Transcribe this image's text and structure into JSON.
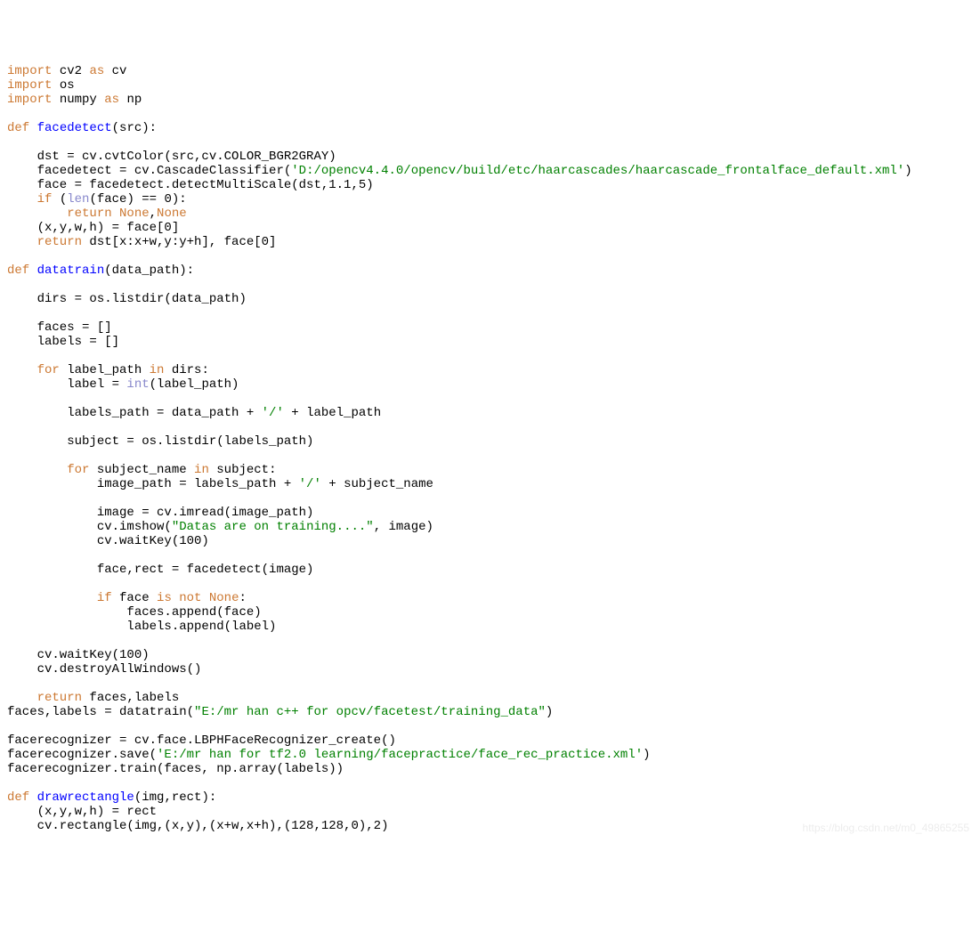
{
  "code": {
    "l1_import": "import",
    "l1_cv2": " cv2 ",
    "l1_as": "as",
    "l1_cv": " cv",
    "l2_import": "import",
    "l2_os": " os",
    "l3_import": "import",
    "l3_numpy": " numpy ",
    "l3_as": "as",
    "l3_np": " np",
    "l5_def": "def",
    "l5_fn": " facedetect",
    "l5_sig": "(src):",
    "l7": "    dst = cv.cvtColor(src,cv.COLOR_BGR2GRAY)",
    "l8a": "    facedetect = cv.CascadeClassifier(",
    "l8s": "'D:/opencv4.4.0/opencv/build/etc/haarcascades/haarcascade_frontalface_default.xml'",
    "l8b": ")",
    "l9": "    face = facedetect.detectMultiScale(dst,1.1,5)",
    "l10_if": "    if",
    "l10a": " (",
    "l10_len": "len",
    "l10b": "(face) == 0):",
    "l11_return": "        return",
    "l11_none": " None",
    "l11_comma": ",",
    "l11_none2": "None",
    "l12": "    (x,y,w,h) = face[0]",
    "l13_return": "    return",
    "l13b": " dst[x:x+w,y:y+h], face[0]",
    "l15_def": "def",
    "l15_fn": " datatrain",
    "l15_sig": "(data_path):",
    "l17": "    dirs = os.listdir(data_path)",
    "l19": "    faces = []",
    "l20": "    labels = []",
    "l22_for": "    for",
    "l22a": " label_path ",
    "l22_in": "in",
    "l22b": " dirs:",
    "l23a": "        label = ",
    "l23_int": "int",
    "l23b": "(label_path)",
    "l25a": "        labels_path = data_path + ",
    "l25s": "'/'",
    "l25b": " + label_path",
    "l27": "        subject = os.listdir(labels_path)",
    "l29_for": "        for",
    "l29a": " subject_name ",
    "l29_in": "in",
    "l29b": " subject:",
    "l30a": "            image_path = labels_path + ",
    "l30s": "'/'",
    "l30b": " + subject_name",
    "l32": "            image = cv.imread(image_path)",
    "l33a": "            cv.imshow(",
    "l33s": "\"Datas are on training....\"",
    "l33b": ", image)",
    "l34": "            cv.waitKey(100)",
    "l36": "            face,rect = facedetect(image)",
    "l38_if": "            if",
    "l38a": " face ",
    "l38_isnot": "is not",
    "l38_none": " None",
    "l38b": ":",
    "l39": "                faces.append(face)",
    "l40": "                labels.append(label)",
    "l42": "    cv.waitKey(100)",
    "l43": "    cv.destroyAllWindows()",
    "l45_return": "    return",
    "l45b": " faces,labels",
    "l46a": "faces,labels = datatrain(",
    "l46s": "\"E:/mr han c++ for opcv/facetest/training_data\"",
    "l46b": ")",
    "l48": "facerecognizer = cv.face.LBPHFaceRecognizer_create()",
    "l49a": "facerecognizer.save(",
    "l49s": "'E:/mr han for tf2.0 learning/facepractice/face_rec_practice.xml'",
    "l49b": ")",
    "l50": "facerecognizer.train(faces, np.array(labels))",
    "l52_def": "def",
    "l52_fn": " drawrectangle",
    "l52_sig": "(img,rect):",
    "l53": "    (x,y,w,h) = rect",
    "l54": "    cv.rectangle(img,(x,y),(x+w,x+h),(128,128,0),2)"
  },
  "watermark": "https://blog.csdn.net/m0_49865255"
}
